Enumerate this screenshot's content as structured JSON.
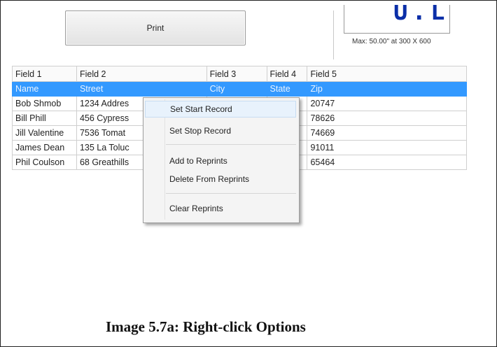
{
  "toolbar": {
    "print_label": "Print"
  },
  "preview": {
    "glyphs": "U.L",
    "max_label": "Max: 50.00\" at 300 X 600"
  },
  "grid": {
    "columns": [
      "Field 1",
      "Field 2",
      "Field 3",
      "Field 4",
      "Field 5"
    ],
    "rows": [
      [
        "Name",
        "Street",
        "City",
        "State",
        "Zip"
      ],
      [
        "Bob Shmob",
        "1234 Addres",
        "",
        "",
        "20747"
      ],
      [
        "Bill Phill",
        "456 Cypress",
        "",
        "",
        "78626"
      ],
      [
        "Jill Valentine",
        "7536 Tomat",
        "",
        "",
        "74669"
      ],
      [
        "James Dean",
        "135 La Toluc",
        "",
        "",
        "91011"
      ],
      [
        "Phil Coulson",
        "68 Greathills",
        "",
        "",
        "65464"
      ]
    ],
    "selected_row": 0
  },
  "context_menu": {
    "items": [
      "Set Start Record",
      "Set Stop Record",
      "Add to Reprints",
      "Delete From Reprints",
      "Clear Reprints"
    ]
  },
  "caption": "Image 5.7a: Right-click Options",
  "colors": {
    "selection": "#3399ff",
    "menu_background": "#f4f4f4",
    "menu_highlight": "#e8f2fc"
  }
}
